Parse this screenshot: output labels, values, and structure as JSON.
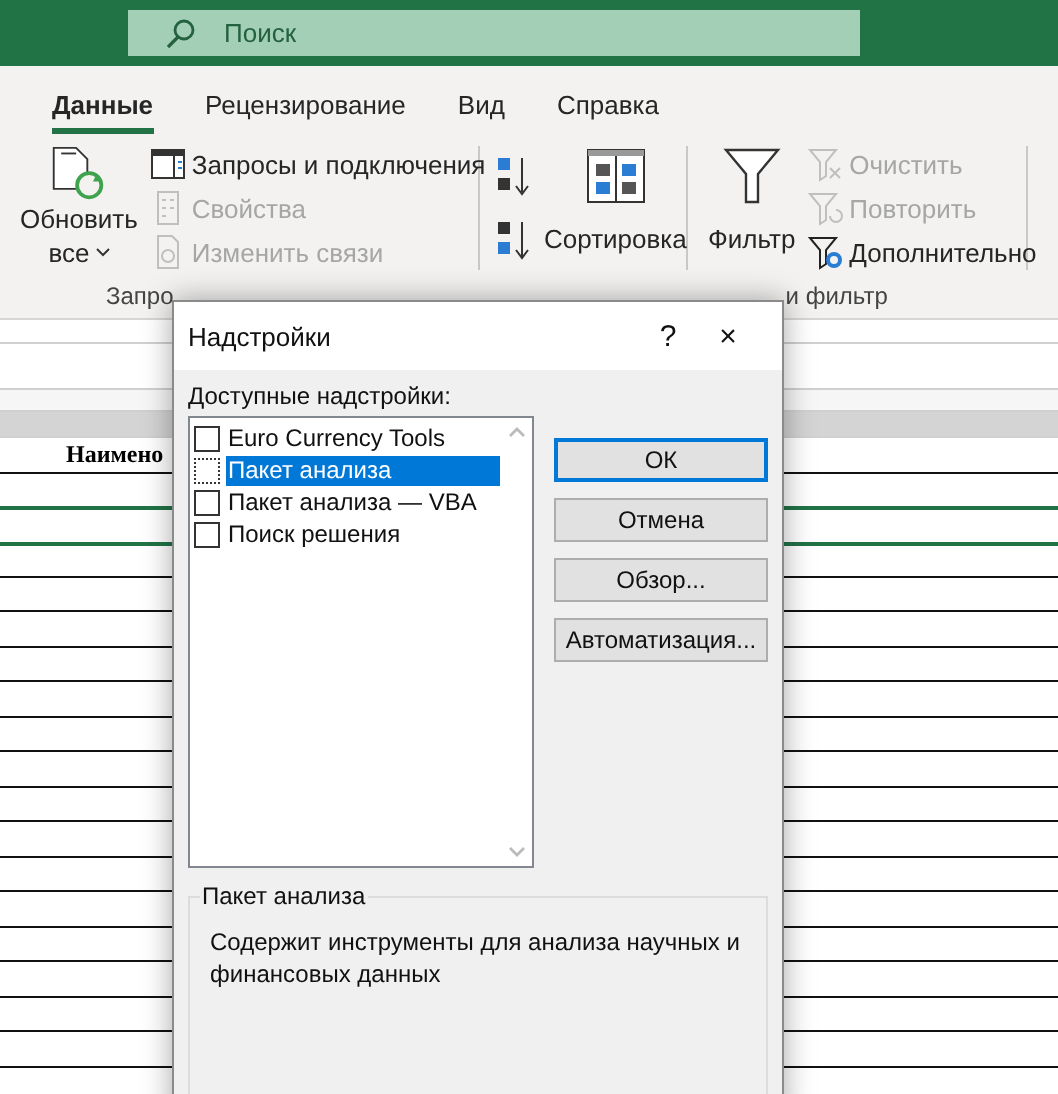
{
  "search": {
    "placeholder": "Поиск"
  },
  "tabs": [
    {
      "label": "Данные",
      "selected": true
    },
    {
      "label": "Рецензирование",
      "selected": false
    },
    {
      "label": "Вид",
      "selected": false
    },
    {
      "label": "Справка",
      "selected": false
    }
  ],
  "ribbon": {
    "refresh": {
      "line1": "Обновить",
      "line2": "все"
    },
    "queries": [
      {
        "kind": "queries",
        "label": "Запросы и подключения",
        "disabled": false
      },
      {
        "kind": "properties",
        "label": "Свойства",
        "disabled": true
      },
      {
        "kind": "links",
        "label": "Изменить связи",
        "disabled": true
      }
    ],
    "sort_button": "Сортировка",
    "filter_button": "Фильтр",
    "filter_commands": [
      {
        "kind": "clear",
        "label": "Очистить",
        "disabled": true
      },
      {
        "kind": "reapply",
        "label": "Повторить",
        "disabled": true
      },
      {
        "kind": "advanced",
        "label": "Дополнительно",
        "disabled": false
      }
    ],
    "group_labels": [
      "Запро",
      "и фильтр"
    ]
  },
  "sheet": {
    "header_cell": "Наимено"
  },
  "dialog": {
    "title": "Надстройки",
    "help": "?",
    "close": "×",
    "list_label": "Доступные надстройки:",
    "items": [
      {
        "label": "Euro Currency Tools",
        "checked": false,
        "selected": false
      },
      {
        "label": "Пакет анализа",
        "checked": false,
        "selected": true
      },
      {
        "label": "Пакет анализа — VBA",
        "checked": false,
        "selected": false
      },
      {
        "label": "Поиск решения",
        "checked": false,
        "selected": false
      }
    ],
    "buttons": [
      {
        "label": "ОК",
        "default": true
      },
      {
        "label": "Отмена",
        "default": false
      },
      {
        "label": "Обзор...",
        "default": false
      },
      {
        "label": "Автоматизация...",
        "default": false
      }
    ],
    "description": {
      "title": "Пакет анализа",
      "text": "Содержит инструменты для анализа научных и финансовых данных"
    }
  }
}
